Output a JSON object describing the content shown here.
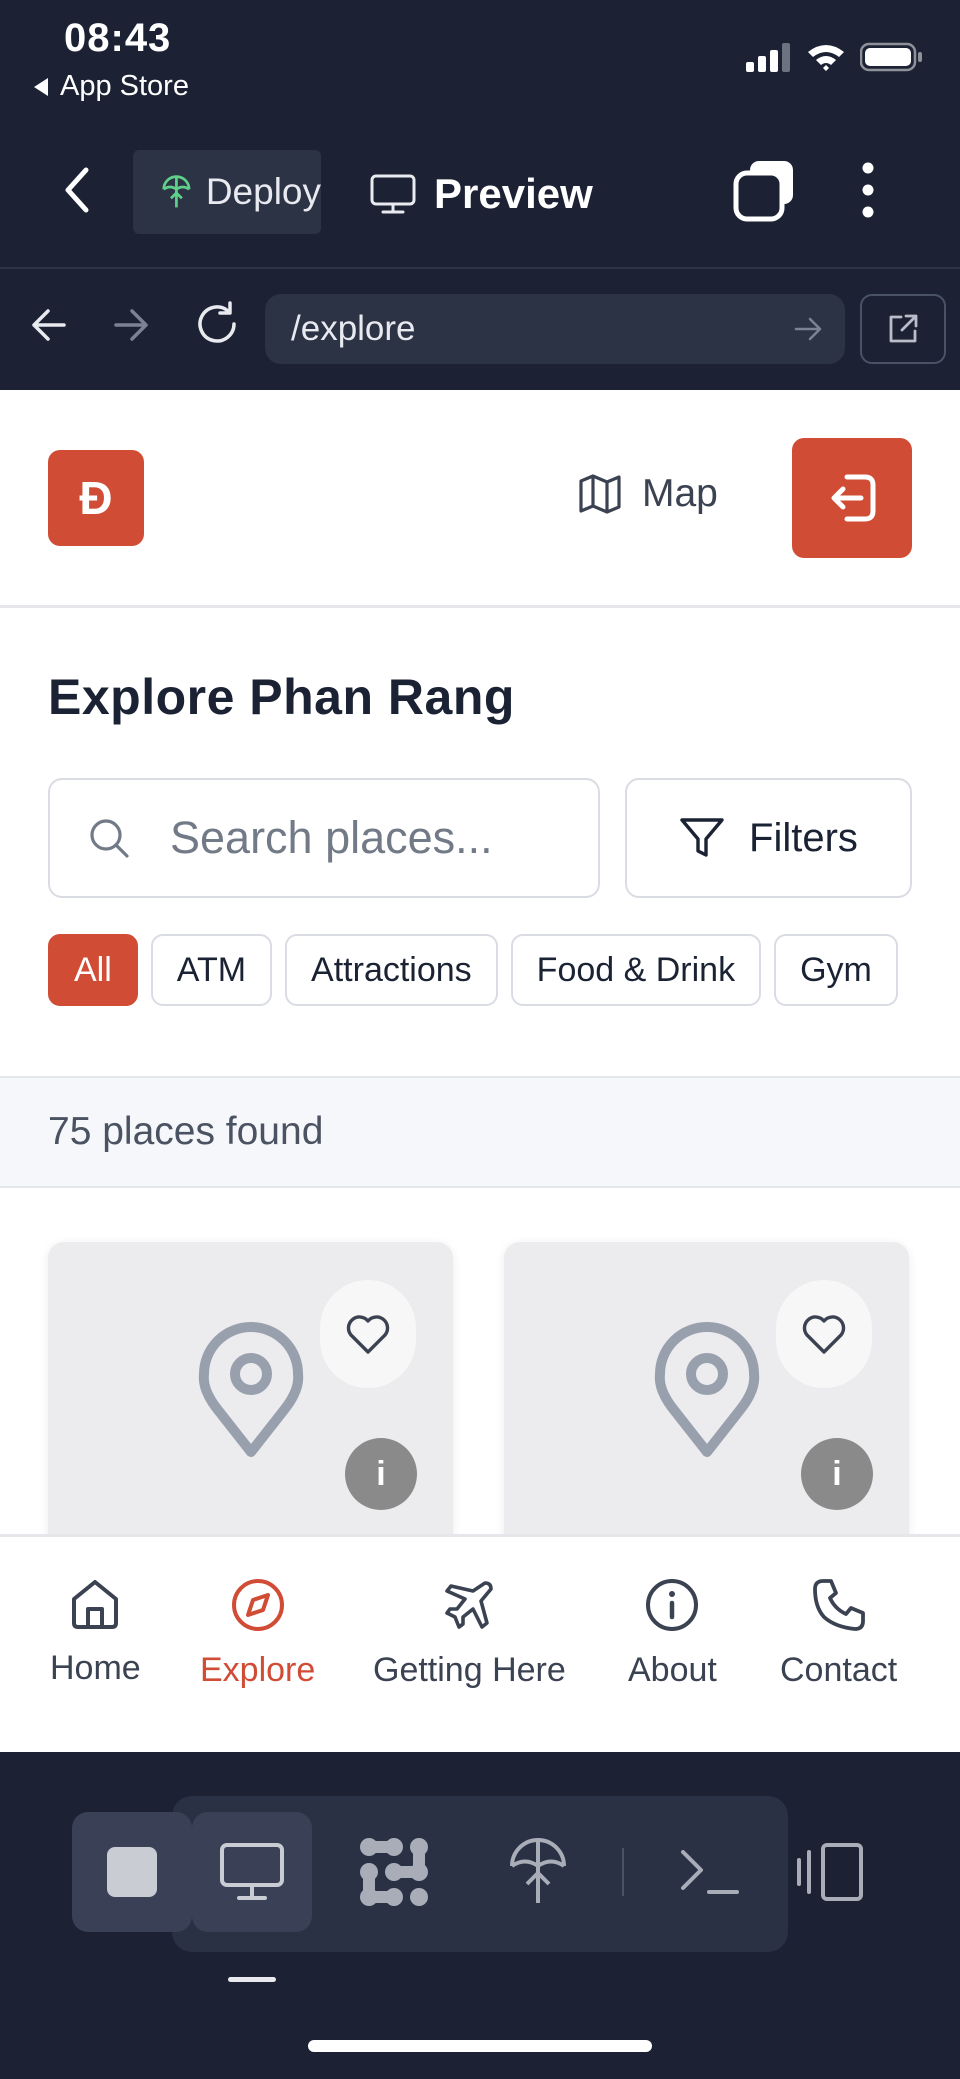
{
  "status_bar": {
    "time": "08:43",
    "back_label": "App Store"
  },
  "toolbar": {
    "deploy_label": "Deploy",
    "preview_label": "Preview"
  },
  "url_bar": {
    "url": "/explore"
  },
  "site": {
    "logo_text": "Đ",
    "map_label": "Map",
    "title": "Explore Phan Rang",
    "search_placeholder": "Search places...",
    "filters_label": "Filters",
    "categories": [
      "All",
      "ATM",
      "Attractions",
      "Food & Drink",
      "Gym"
    ],
    "active_category": "All",
    "results_text": "75 places found",
    "card_info_label": "i",
    "bottom_nav": [
      {
        "label": "Home",
        "icon": "home-icon"
      },
      {
        "label": "Explore",
        "icon": "compass-icon",
        "active": true
      },
      {
        "label": "Getting Here",
        "icon": "plane-icon"
      },
      {
        "label": "About",
        "icon": "info-icon"
      },
      {
        "label": "Contact",
        "icon": "phone-icon"
      }
    ]
  },
  "colors": {
    "brand": "#d14c35",
    "app_chrome": "#1c2233",
    "field_bg": "#2c3345"
  }
}
